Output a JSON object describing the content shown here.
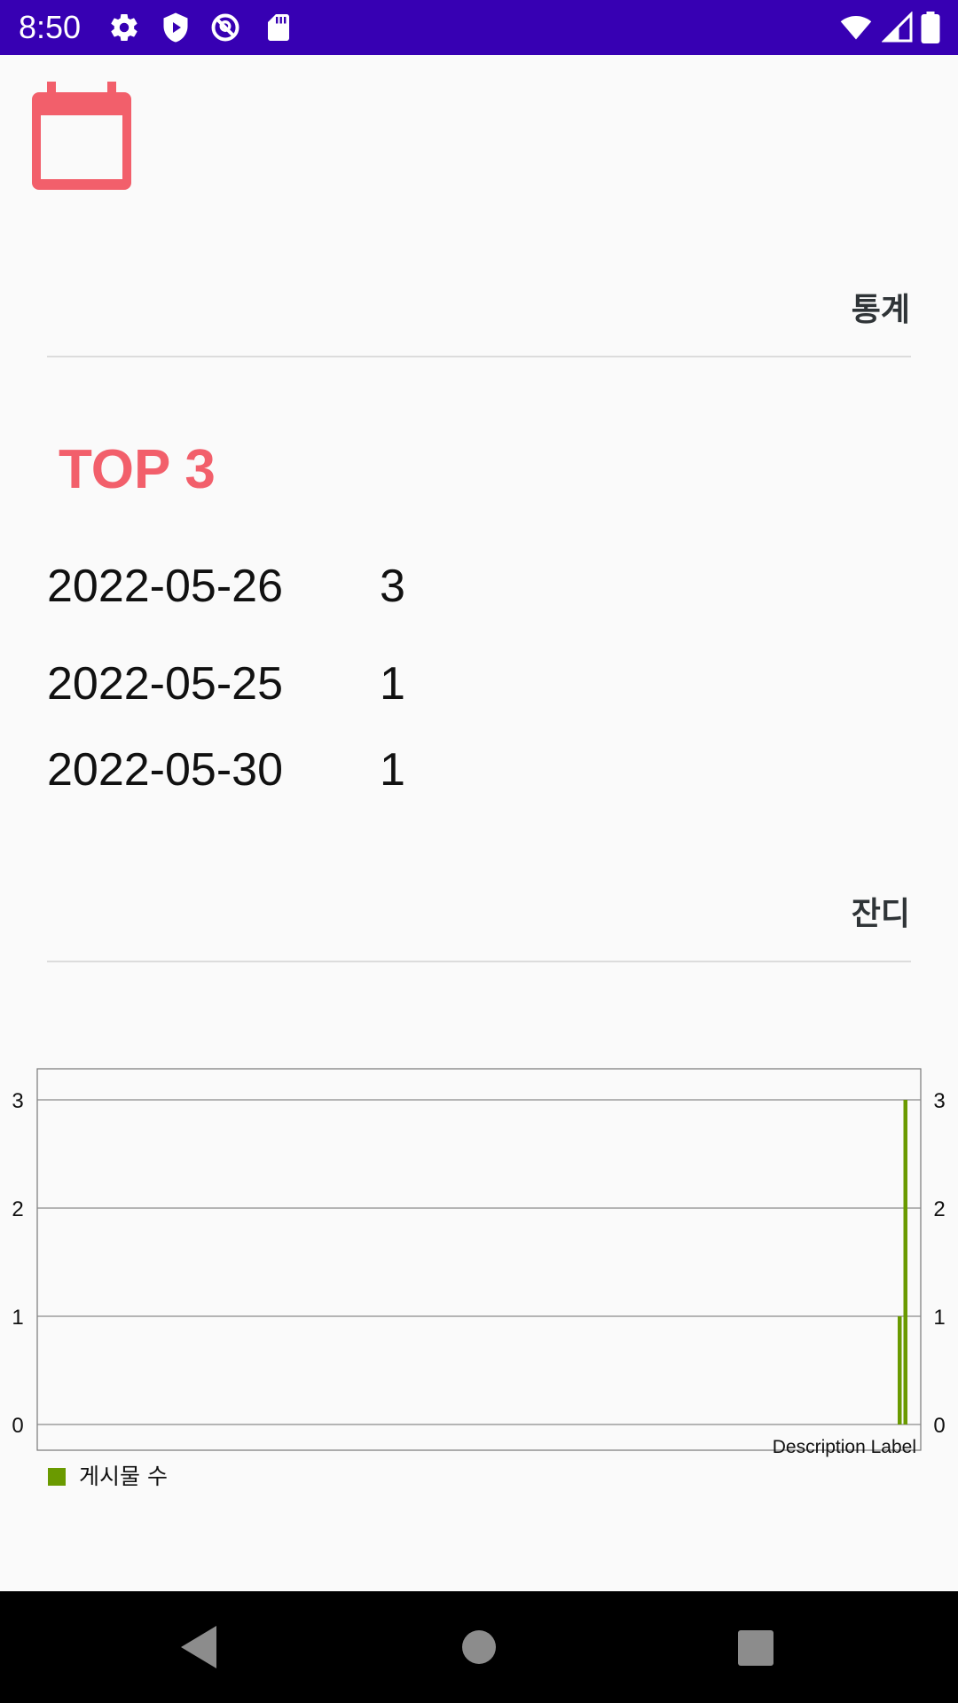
{
  "status_bar": {
    "time": "8:50",
    "background": "#3700b3",
    "left_icons": [
      "gear-icon",
      "shield-play-icon",
      "no-location-icon",
      "sd-card-icon"
    ],
    "right_icons": [
      "wifi-icon",
      "cellular-signal-icon",
      "battery-icon"
    ]
  },
  "header": {
    "icon": "calendar-icon",
    "accent_color": "#f25f6b"
  },
  "stats_section": {
    "title": "통계"
  },
  "top3": {
    "title": "TOP 3",
    "rows": [
      {
        "date": "2022-05-26",
        "count": "3"
      },
      {
        "date": "2022-05-25",
        "count": "1"
      },
      {
        "date": "2022-05-30",
        "count": "1"
      }
    ]
  },
  "grass_section": {
    "title": "잔디"
  },
  "chart_data": {
    "type": "bar",
    "description": "Description Label",
    "series": [
      {
        "name": "게시물 수",
        "color": "#6a9a00",
        "values": [
          1,
          3
        ]
      }
    ],
    "ylim": [
      0,
      3
    ],
    "yticks_left": [
      "0",
      "1",
      "2",
      "3"
    ],
    "yticks_right": [
      "0",
      "1",
      "2",
      "3"
    ],
    "grid": true,
    "legend_position": "bottom-left"
  },
  "nav_bar": {
    "buttons": [
      "back-icon",
      "home-icon",
      "recents-icon"
    ]
  }
}
